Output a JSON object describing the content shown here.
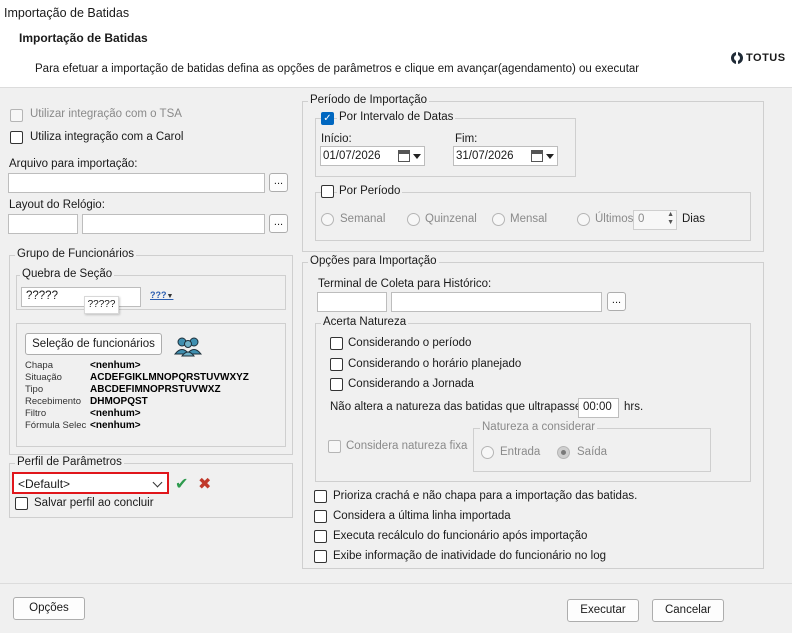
{
  "window": {
    "title": "Importação de Batidas"
  },
  "header": {
    "title": "Importação de Batidas",
    "subtitle": "Para efetuar a importação de batidas defina as opções de parâmetros e clique em avançar(agendamento) ou executar",
    "brand": "TOTUS"
  },
  "left": {
    "use_tsa": "Utilizar integração com o TSA",
    "use_carol": "Utiliza integração com a Carol",
    "import_file_label": "Arquivo para importação:",
    "import_file_value": "",
    "clock_layout_label": "Layout do Relógio:",
    "browse": "...",
    "employee_group": {
      "legend": "Grupo de Funcionários",
      "section_break_legend": "Quebra de Seção",
      "section_value": "?????",
      "section_tooltip": "?????",
      "mask_button": "???",
      "select_employees_button": "Seleção de funcionários",
      "info": [
        {
          "label": "Chapa",
          "value": "<nenhum>"
        },
        {
          "label": "Situação",
          "value": "ACDEFGIKLMNOPQRSTUVWXYZ"
        },
        {
          "label": "Tipo",
          "value": "ABCDEFIMNOPRSTUVWXZ"
        },
        {
          "label": "Recebimento",
          "value": "DHMOPQST"
        },
        {
          "label": "Filtro",
          "value": "<nenhum>"
        },
        {
          "label": "Fórmula Selec",
          "value": "<nenhum>"
        }
      ]
    },
    "profile": {
      "legend": "Perfil de Parâmetros",
      "selected": "<Default>",
      "save_on_finish": "Salvar perfil ao concluir"
    }
  },
  "period": {
    "legend": "Período de Importação",
    "by_date_range": "Por Intervalo de Datas",
    "start_label": "Início:",
    "start_value": "01/07/2026",
    "end_label": "Fim:",
    "end_value": "31/07/2026",
    "by_period": "Por Período",
    "options": [
      "Semanal",
      "Quinzenal",
      "Mensal"
    ],
    "last_label": "Últimos",
    "last_value": "0",
    "days_label": "Dias"
  },
  "import_options": {
    "legend": "Opções para Importação",
    "terminal_label": "Terminal de Coleta para Histórico:",
    "acerta_natureza": {
      "legend": "Acerta Natureza",
      "items": [
        "Considerando o período",
        "Considerando o horário planejado",
        "Considerando a Jornada"
      ],
      "no_change_label": "Não altera a natureza das batidas que ultrapassem",
      "time_value": "00:00",
      "hours_unit": "hrs.",
      "fixed_nature": "Considera natureza fixa",
      "nature_legend": "Natureza a considerar",
      "entrada": "Entrada",
      "saida": "Saída"
    },
    "checks": [
      "Prioriza crachá e não chapa para a importação das batidas.",
      "Considera a última linha importada",
      "Executa recálculo do funcionário após importação",
      "Exibe informação de inatividade do funcionário no log"
    ]
  },
  "footer": {
    "options": "Opções",
    "execute": "Executar",
    "cancel": "Cancelar"
  },
  "colors": {
    "accent": "#0067c0",
    "highlight": "#e0161b",
    "confirm": "#2e9b4e",
    "reject": "#c0392b"
  }
}
